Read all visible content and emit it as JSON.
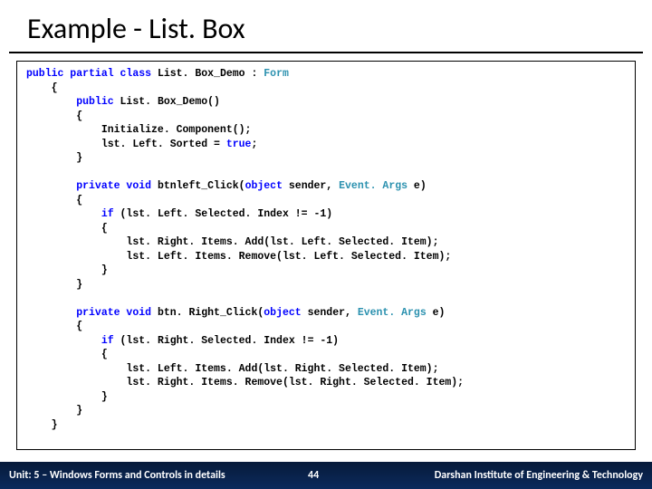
{
  "title": "Example - List. Box",
  "code": {
    "l1a": "public partial class",
    "l1b": "List. Box_Demo",
    "l1c": ":",
    "l1d": "Form",
    "l2": "    {",
    "l3a": "        public",
    "l3b": "List. Box_Demo()",
    "l4": "        {",
    "l5": "            Initialize. Component();",
    "l6a": "            lst. Left. Sorted = ",
    "l6b": "true",
    "l6c": ";",
    "l7": "        }",
    "bl1": "",
    "l8a": "        private void",
    "l8b": "btnleft_Click(",
    "l8c": "object",
    "l8d": "sender, ",
    "l8e": "Event. Args",
    "l8f": " e)",
    "l9": "        {",
    "l10a": "            if",
    "l10b": "(lst. Left. Selected. Index != -1)",
    "l11": "            {",
    "l12": "                lst. Right. Items. Add(lst. Left. Selected. Item);",
    "l13": "                lst. Left. Items. Remove(lst. Left. Selected. Item);",
    "l14": "            }",
    "l15": "        }",
    "bl2": "",
    "l16a": "        private void",
    "l16b": "btn. Right_Click(",
    "l16c": "object",
    "l16d": "sender, ",
    "l16e": "Event. Args",
    "l16f": " e)",
    "l17": "        {",
    "l18a": "            if",
    "l18b": "(lst. Right. Selected. Index != -1)",
    "l19": "            {",
    "l20": "                lst. Left. Items. Add(lst. Right. Selected. Item);",
    "l21": "                lst. Right. Items. Remove(lst. Right. Selected. Item);",
    "l22": "            }",
    "l23": "        }",
    "l24": "    }"
  },
  "footer": {
    "left": "Unit: 5 – Windows Forms and Controls in details",
    "page": "44",
    "right": "Darshan Institute of Engineering & Technology"
  }
}
